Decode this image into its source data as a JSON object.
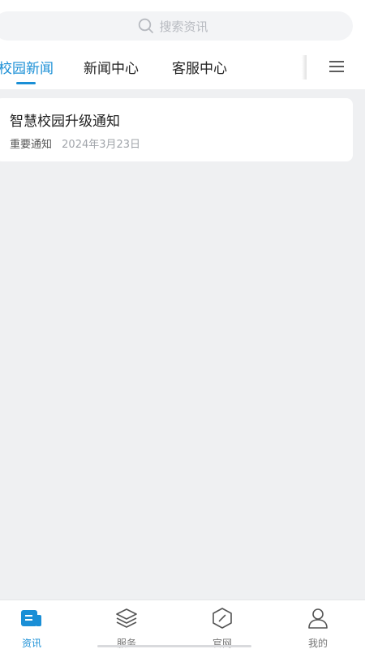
{
  "search": {
    "placeholder": "搜索资讯"
  },
  "tabs": [
    {
      "label": "校园新闻",
      "active": true
    },
    {
      "label": "新闻中心",
      "active": false
    },
    {
      "label": "客服中心",
      "active": false
    }
  ],
  "colors": {
    "accent": "#1a8fd6",
    "background": "#eff0f2"
  },
  "news": [
    {
      "title": "智慧校园升级通知",
      "tag": "重要通知",
      "date": "2024年3月23日"
    }
  ],
  "bottom_nav": [
    {
      "label": "资讯",
      "icon": "news-icon",
      "active": true
    },
    {
      "label": "服务",
      "icon": "layers-icon",
      "active": false
    },
    {
      "label": "官网",
      "icon": "compass-icon",
      "active": false
    },
    {
      "label": "我的",
      "icon": "user-icon",
      "active": false
    }
  ]
}
